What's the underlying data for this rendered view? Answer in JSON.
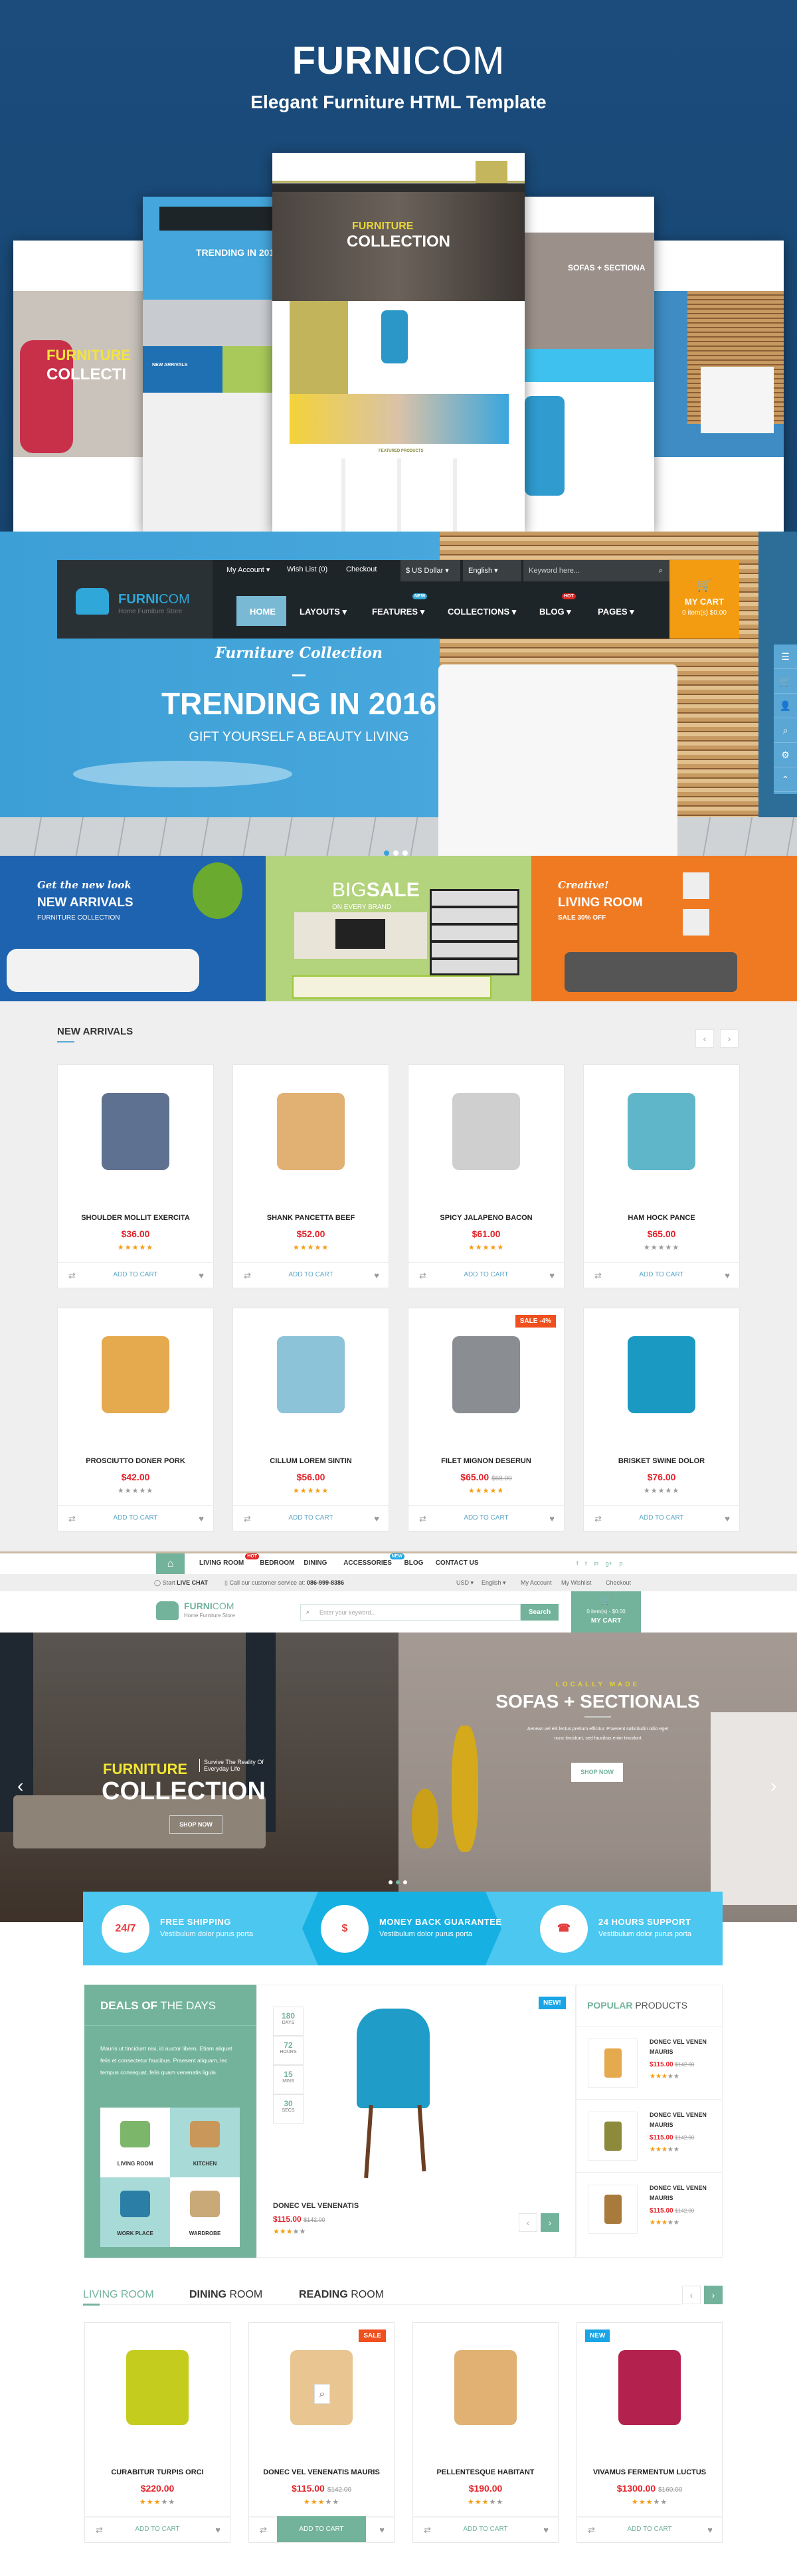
{
  "promo": {
    "brand_bold": "FURNI",
    "brand_light": "COM",
    "subtitle": "Elegant Furniture HTML Template",
    "mockups": {
      "center_title1": "FURNITURE",
      "center_title2": "COLLECTION",
      "left_title": "TRENDING IN 201",
      "left_sub": "NEW ARRIVALS",
      "right_title": "SOFAS + SECTIONA",
      "edge_title1": "FURNITURE",
      "edge_title2": "COLLECTI",
      "center_section": "FEATURED PRODUCTS"
    }
  },
  "layout1": {
    "brand_bold": "FURNI",
    "brand_light": "COM",
    "tagline": "Home Furniture Store",
    "top_links": [
      "My Account ▾",
      "Wish List (0)",
      "Checkout"
    ],
    "currency": "$ US Dollar ▾",
    "language": "English ▾",
    "search_placeholder": "Keyword here...",
    "nav": [
      {
        "label": "HOME"
      },
      {
        "label": "LAYOUTS ▾"
      },
      {
        "label": "FEATURES ▾",
        "badge": "NEW"
      },
      {
        "label": "COLLECTIONS ▾"
      },
      {
        "label": "BLOG ▾",
        "badge": "HOT"
      },
      {
        "label": "PAGES ▾"
      }
    ],
    "cart": {
      "label": "MY CART",
      "summary": "0 item(s) $0.00"
    },
    "hero": {
      "script": "Furniture Collection",
      "title": "TRENDING IN 2016",
      "subtitle": "GIFT YOURSELF A BEAUTY LIVING"
    },
    "banners": [
      {
        "script": "Get the new look",
        "title": "NEW ARRIVALS",
        "sub": "FURNITURE COLLECTION"
      },
      {
        "title_light": "BIG",
        "title_bold": "SALE",
        "sub": "ON EVERY BRAND"
      },
      {
        "script": "Creative!",
        "title": "LIVING ROOM",
        "sub": "SALE 30% OFF"
      }
    ],
    "arrivals": {
      "heading": "NEW ARRIVALS",
      "add_to_cart": "ADD TO CART",
      "products": [
        {
          "name": "SHOULDER MOLLIT EXERCITA",
          "price": "$36.00",
          "rating": 5,
          "color": "#5f7190"
        },
        {
          "name": "SHANK PANCETTA BEEF",
          "price": "$52.00",
          "rating": 5,
          "color": "#e0b173"
        },
        {
          "name": "SPICY JALAPENO BACON",
          "price": "$61.00",
          "rating": 5,
          "color": "#cfcfcf"
        },
        {
          "name": "HAM HOCK PANCE",
          "price": "$65.00",
          "rating": 0,
          "color": "#5fb6c9"
        },
        {
          "name": "PROSCIUTTO DONER PORK",
          "price": "$42.00",
          "rating": 0,
          "color": "#e5a94e"
        },
        {
          "name": "CILLUM LOREM SINTIN",
          "price": "$56.00",
          "rating": 5,
          "color": "#8cc3d9"
        },
        {
          "name": "FILET MIGNON DESERUN",
          "price": "$65.00",
          "old_price": "$68.00",
          "rating": 5,
          "badge": "SALE -4%",
          "color": "#8a8d92"
        },
        {
          "name": "BRISKET SWINE DOLOR",
          "price": "$76.00",
          "rating": 0,
          "color": "#1a9ac2"
        }
      ]
    }
  },
  "layout2": {
    "nav": [
      {
        "label": "LIVING ROOM",
        "badge": "HOT"
      },
      {
        "label": "BEDROOM"
      },
      {
        "label": "DINING"
      },
      {
        "label": "ACCESSORIES",
        "badge": "NEW"
      },
      {
        "label": "BLOG"
      },
      {
        "label": "CONTACT US"
      }
    ],
    "social": [
      "f",
      "t",
      "in",
      "g+",
      "p"
    ],
    "live_chat_prefix": "Start",
    "live_chat": "LIVE CHAT",
    "phone_label": "Call our customer service at:",
    "phone": "086-999-8386",
    "currency": "USD ▾",
    "language": "English ▾",
    "account_links": [
      "My Account",
      "My Wishlist",
      "Checkout"
    ],
    "brand_bold": "FURNI",
    "brand_light": "COM",
    "tagline": "Home Furniture Store",
    "search_placeholder": "Enter your keyword...",
    "search_button": "Search",
    "cart": {
      "summary": "0 item(s) - $0.00",
      "label": "MY CART"
    },
    "slides": [
      {
        "title1": "FURNITURE",
        "side": "Survive The Reality Of Everyday Life",
        "title2": "COLLECTION",
        "button": "SHOP NOW"
      },
      {
        "kicker": "LOCALLY MADE",
        "title": "SOFAS + SECTIONALS",
        "text1": "Aenean vel elit lectus pretium efficitur. Praesent sollicitudin odio eget",
        "text2": "nunc tincidunt, sed faucibus enim tincidunt",
        "button": "SHOP NOW"
      }
    ],
    "features": [
      {
        "title": "FREE SHIPPING",
        "sub": "Vestibulum dolor purus porta",
        "icon": "truck-icon",
        "glyph": "24/7"
      },
      {
        "title": "MONEY BACK GUARANTEE",
        "sub": "Vestibulum dolor purus porta",
        "icon": "purse-icon",
        "glyph": "$"
      },
      {
        "title": "24 HOURS SUPPORT",
        "sub": "Vestibulum dolor purus porta",
        "icon": "phone-icon",
        "glyph": "☎"
      }
    ],
    "deals": {
      "title_bold": "DEALS OF",
      "title_light": "THE DAYS",
      "text": "Mauris ut tincidunt nisi, id auctor libero. Etiam aliquet felis et consectetur faucibus. Praesent aliquam, lec tempus consequat, felis quam venenatis ligula.",
      "categories": [
        "LIVING ROOM",
        "KITCHEN",
        "WORK PLACE",
        "WARDROBE"
      ],
      "countdown": [
        {
          "value": "180",
          "unit": "DAYS"
        },
        {
          "value": "72",
          "unit": "HOURS"
        },
        {
          "value": "15",
          "unit": "MINS"
        },
        {
          "value": "30",
          "unit": "SECS"
        }
      ],
      "badge": "NEW!",
      "product": {
        "name": "DONEC VEL VENENATIS",
        "price": "$115.00",
        "old_price": "$142.00",
        "rating": 3
      }
    },
    "popular": {
      "title_bold": "POPULAR",
      "title_light": "PRODUCTS",
      "items": [
        {
          "name": "DONEC VEL VENEN MAURIS",
          "price": "$115.00",
          "old_price": "$142.00",
          "rating": 3,
          "color": "#e5a94e"
        },
        {
          "name": "DONEC VEL VENEN MAURIS",
          "price": "$115.00",
          "old_price": "$142.00",
          "rating": 3,
          "color": "#8d8a3c"
        },
        {
          "name": "DONEC VEL VENEN MAURIS",
          "price": "$115.00",
          "old_price": "$142.00",
          "rating": 3,
          "color": "#a87a3c"
        }
      ]
    },
    "tabs": [
      {
        "bold": "LIVING",
        "light": "ROOM",
        "active": true
      },
      {
        "bold": "DINING",
        "light": "ROOM"
      },
      {
        "bold": "READING",
        "light": "ROOM"
      }
    ],
    "add_to_cart": "ADD TO CART",
    "products": [
      {
        "name": "CURABITUR TURPIS ORCI",
        "price": "$220.00",
        "rating": 3,
        "color": "#c4cc1e"
      },
      {
        "name": "DONEC VEL VENENATIS MAURIS",
        "price": "$115.00",
        "old_price": "$142.00",
        "rating": 3,
        "badge": "SALE",
        "color": "#e9c591",
        "hover": true
      },
      {
        "name": "PELLENTESQUE HABITANT",
        "price": "$190.00",
        "rating": 3,
        "color": "#e0b173"
      },
      {
        "name": "VIVAMUS FERMENTUM LUCTUS",
        "price": "$1300.00",
        "old_price": "$160.00",
        "rating": 3,
        "badge": "NEW",
        "color": "#b3214e"
      }
    ]
  },
  "colors": {
    "accent_blue": "#4aa9dd",
    "accent_orange": "#f39c12",
    "accent_green": "#73b39b",
    "price_red": "#e2232a",
    "star_orange": "#f39c12",
    "star_gray": "#999999"
  }
}
